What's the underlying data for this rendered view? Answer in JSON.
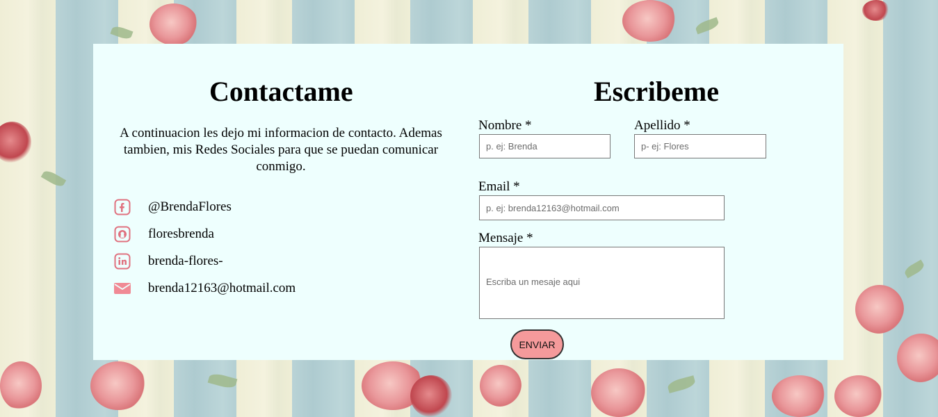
{
  "contact": {
    "title": "Contactame",
    "intro": "A continuacion les dejo mi informacion de contacto. Ademas tambien, mis Redes Sociales para que se puedan comunicar conmigo.",
    "items": [
      {
        "icon": "facebook-icon",
        "text": "@BrendaFlores"
      },
      {
        "icon": "github-icon",
        "text": "floresbrenda"
      },
      {
        "icon": "linkedin-icon",
        "text": "brenda-flores-"
      },
      {
        "icon": "mail-icon",
        "text": "brenda12163@hotmail.com"
      }
    ]
  },
  "form": {
    "title": "Escribeme",
    "nombre_label": "Nombre *",
    "nombre_placeholder": "p. ej: Brenda",
    "apellido_label": "Apellido *",
    "apellido_placeholder": "p- ej: Flores",
    "email_label": "Email *",
    "email_placeholder": "p. ej: brenda12163@hotmail.com",
    "mensaje_label": "Mensaje *",
    "mensaje_placeholder": "Escriba un mesaje aqui",
    "submit_label": "ENVIAR"
  },
  "colors": {
    "card_background": "#eefffe",
    "icon_pink": "#e0717f",
    "button_background": "#f59a9b"
  }
}
